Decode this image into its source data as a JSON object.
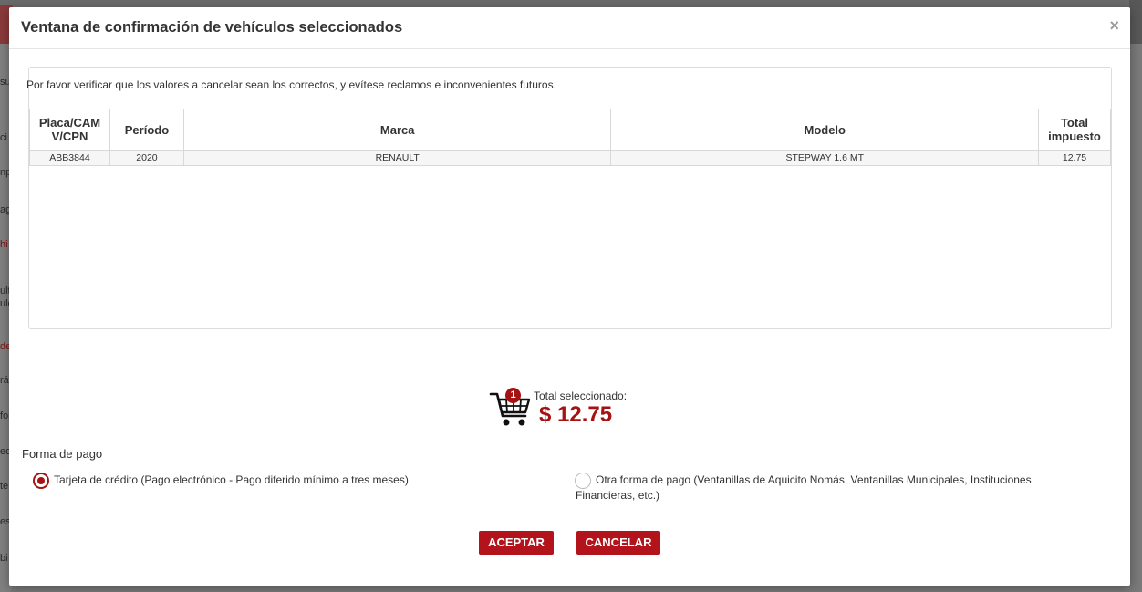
{
  "modal": {
    "title": "Ventana de confirmación de vehículos seleccionados",
    "close_label": "×",
    "instructions": "Por favor verificar que los valores a cancelar sean los correctos, y evítese reclamos e inconvenientes futuros."
  },
  "table": {
    "headers": [
      "Placa/CAM V/CPN",
      "Período",
      "Marca",
      "Modelo",
      "Total impuesto"
    ],
    "rows": [
      [
        "ABB3844",
        "2020",
        "RENAULT",
        "STEPWAY 1.6 MT",
        "12.75"
      ]
    ]
  },
  "summary": {
    "cart_count": "1",
    "total_label": "Total seleccionado:",
    "total_amount": "$ 12.75"
  },
  "payment": {
    "title": "Forma de pago",
    "options": [
      {
        "label": "Tarjeta de crédito (Pago electrónico - Pago diferido mínimo a tres meses)",
        "selected": true
      },
      {
        "label": "Otra forma de pago (Ventanillas de Aquicito Nomás, Ventanillas Municipales, Instituciones Financieras, etc.)",
        "selected": false
      }
    ]
  },
  "buttons": {
    "accept": "ACEPTAR",
    "cancel": "CANCELAR"
  },
  "background": {
    "sidebar_fragments": [
      "su",
      "ci",
      "np",
      "ag",
      "hi",
      "ult",
      "ulo",
      "de",
      "rá",
      "foi",
      "eo",
      "te",
      "es",
      "bi"
    ]
  },
  "colors": {
    "accent": "#a51212",
    "button": "#b3141b"
  }
}
